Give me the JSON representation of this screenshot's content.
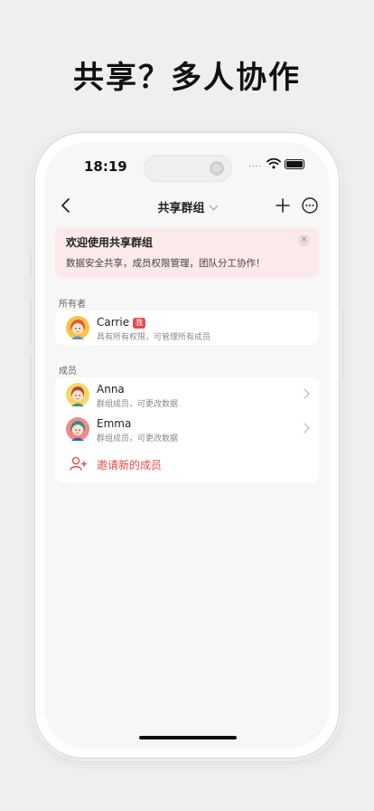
{
  "headline": "共享？多人协作",
  "status_bar": {
    "time": "18:19",
    "signal_dots": "...."
  },
  "nav": {
    "title": "共享群组",
    "icons": [
      "back-chevron-icon",
      "chevron-down-icon",
      "plus-icon",
      "more-circle-icon"
    ]
  },
  "banner": {
    "title": "欢迎使用共享群组",
    "text": "数据安全共享，成员权限管理，团队分工协作！",
    "close_glyph": "×",
    "bg_color": "#fce9e9"
  },
  "owner_section": {
    "label": "所有者",
    "owner": {
      "name": "Carrie",
      "badge": "我",
      "subtitle": "具有所有权限，可管理所有成员"
    }
  },
  "members_section": {
    "label": "成员",
    "members": [
      {
        "name": "Anna",
        "subtitle": "群组成员，可更改数据"
      },
      {
        "name": "Emma",
        "subtitle": "群组成员，可更改数据"
      }
    ],
    "invite_label": "邀请新的成员"
  },
  "colors": {
    "accent": "#e84a4a",
    "background": "#f0efef",
    "screen": "#f7f7f7"
  }
}
